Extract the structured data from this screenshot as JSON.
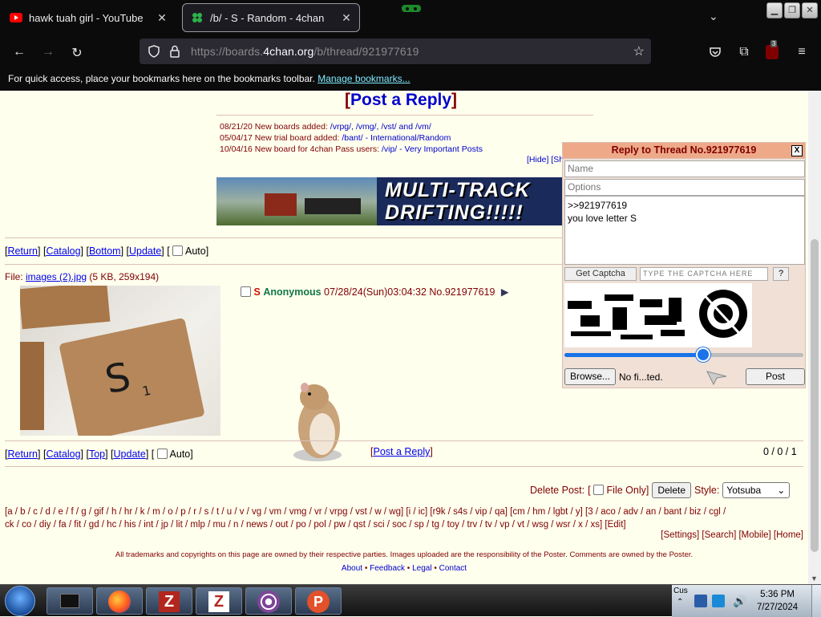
{
  "browser": {
    "tabs": [
      {
        "title": "hawk tuah girl - YouTube",
        "active": false,
        "icon": "youtube-icon"
      },
      {
        "title": "/b/ - S - Random - 4chan",
        "active": true,
        "icon": "4chan-clover-icon"
      }
    ],
    "url_prefix": "https://boards.",
    "url_domain": "4chan.org",
    "url_path": "/b/thread/921977619",
    "bookmarks_text": "For quick access, place your bookmarks here on the bookmarks toolbar.",
    "bookmarks_link": "Manage bookmarks...",
    "extension_badge": "3"
  },
  "page": {
    "post_reply_title": "Post a Reply",
    "news": [
      {
        "date": "08/21/20",
        "text": "New boards added:",
        "links": "/vrpg/, /vmg/, /vst/ and /vm/"
      },
      {
        "date": "05/04/17",
        "text": "New trial board added:",
        "links": "/bant/ - International/Random"
      },
      {
        "date": "10/04/16",
        "text": "New board for 4chan Pass users:",
        "links": "/vip/ - Very Important Posts"
      }
    ],
    "news_hide": "[Hide]",
    "news_show": "[Sh",
    "banner_text_1": "MULTI-TRACK",
    "banner_text_2": "DRIFTING!!!!!",
    "top_nav": {
      "return": "Return",
      "catalog": "Catalog",
      "bottom": "Bottom",
      "update": "Update",
      "auto": "Auto"
    },
    "bottom_nav": {
      "return": "Return",
      "catalog": "Catalog",
      "top": "Top",
      "update": "Update",
      "auto": "Auto"
    },
    "file": {
      "label": "File:",
      "name": "images (2).jpg",
      "meta": "(5 KB, 259x194)"
    },
    "post": {
      "subject": "S",
      "name": "Anonymous",
      "datetime": "07/28/24(Sun)03:04:32",
      "number": "No.921977619",
      "menu": "▶"
    },
    "bottom_post_reply": "Post a Reply",
    "counts": "0 / 0 / 1",
    "delete": {
      "label": "Delete Post:",
      "file_only": "File Only",
      "button": "Delete",
      "style_label": "Style:",
      "style_value": "Yotsuba"
    },
    "boards_line1": "[a / b / c / d / e / f / g / gif / h / hr / k / m / o / p / r / s / t / u / v / vg / vm / vmg / vr / vrpg / vst / w / wg] [i / ic] [r9k / s4s / vip / qa] [cm / hm / lgbt / y] [3 / aco / adv / an / bant / biz / cgl /",
    "boards_line2": "ck / co / diy / fa / fit / gd / hc / his / int / jp / lit / mlp / mu / n / news / out / po / pol / pw / qst / sci / soc / sp / tg / toy / trv / tv / vp / vt / wsg / wsr / x / xs] [Edit]",
    "boards_right": "[Settings] [Search] [Mobile] [Home]",
    "disclaimer": "All trademarks and copyrights on this page are owned by their respective parties. Images uploaded are the responsibility of the Poster. Comments are owned by the Poster.",
    "footer": {
      "about": "About",
      "feedback": "Feedback",
      "legal": "Legal",
      "contact": "Contact"
    }
  },
  "quick_reply": {
    "title": "Reply to Thread No.921977619",
    "close": "X",
    "name_placeholder": "Name",
    "options_placeholder": "Options",
    "comment": ">>921977619\nyou love letter S",
    "get_captcha": "Get Captcha",
    "captcha_placeholder": "TYPE THE CAPTCHA HERE",
    "help": "?",
    "slider_value": 0.58,
    "browse": "Browse...",
    "no_file": "No fi...ted.",
    "post": "Post"
  },
  "taskbar": {
    "apps": [
      "terminal-app",
      "firefox-app",
      "filezilla-app",
      "filezilla-app-2",
      "tor-app",
      "psiphon-app"
    ],
    "tray_label": "Cus",
    "time": "5:36 PM",
    "date": "7/27/2024"
  }
}
